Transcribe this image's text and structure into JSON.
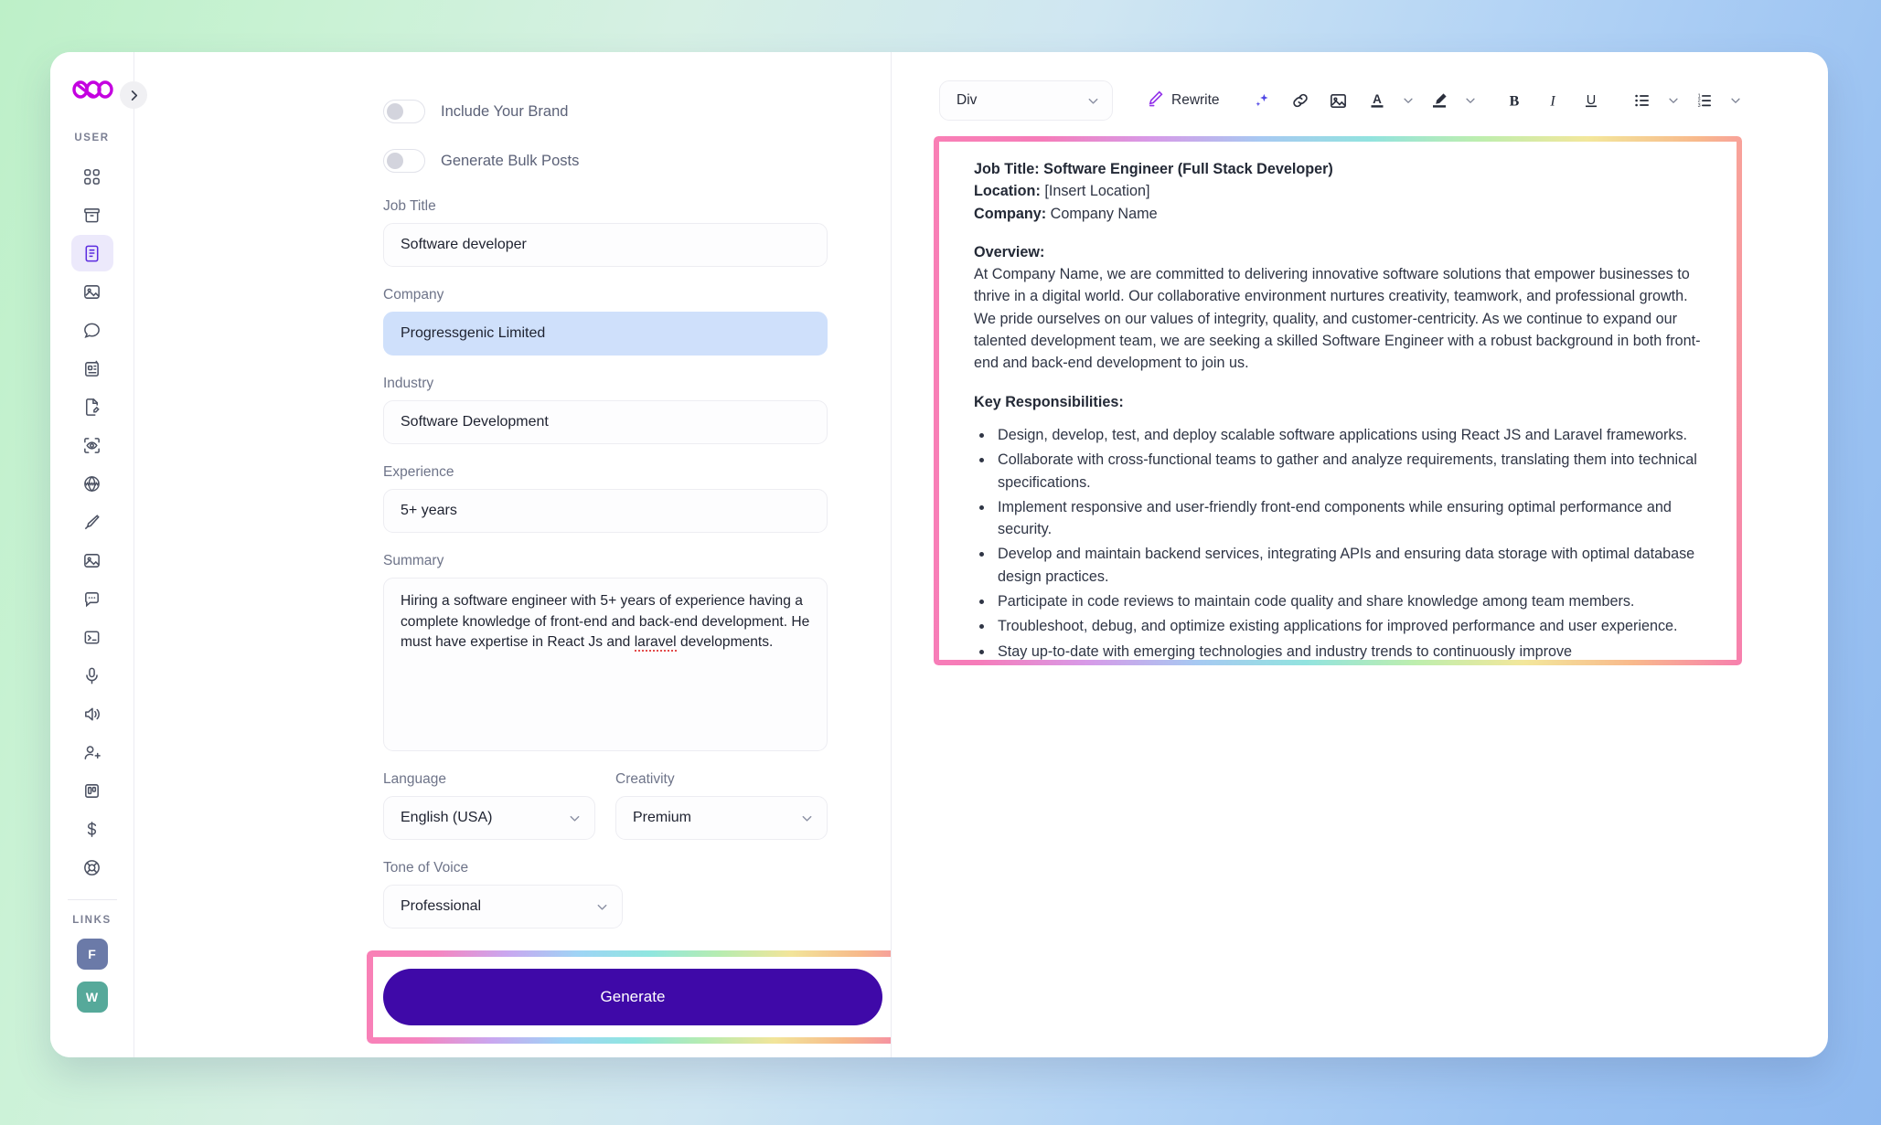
{
  "app": {
    "brand_logo": "infinity-hearts-logo",
    "collapse_icon": "chevron-right-icon"
  },
  "sidebar": {
    "section_label": "USER",
    "links_label": "LINKS",
    "items": [
      {
        "name": "dashboard-grid",
        "icon": "grid-icon",
        "active": false
      },
      {
        "name": "archive",
        "icon": "archive-box-icon",
        "active": false
      },
      {
        "name": "documents",
        "icon": "document-text-icon",
        "active": true
      },
      {
        "name": "images",
        "icon": "image-icon",
        "active": false
      },
      {
        "name": "chat",
        "icon": "chat-bubble-icon",
        "active": false
      },
      {
        "name": "templates",
        "icon": "file-card-icon",
        "active": false
      },
      {
        "name": "editor",
        "icon": "file-pencil-icon",
        "active": false
      },
      {
        "name": "vision",
        "icon": "scan-eye-icon",
        "active": false
      },
      {
        "name": "web",
        "icon": "www-globe-icon",
        "active": false
      },
      {
        "name": "design",
        "icon": "pen-tool-icon",
        "active": false
      },
      {
        "name": "gallery",
        "icon": "photo-icon",
        "active": false
      },
      {
        "name": "comments",
        "icon": "message-dots-icon",
        "active": false
      },
      {
        "name": "code",
        "icon": "terminal-icon",
        "active": false
      },
      {
        "name": "voice",
        "icon": "microphone-icon",
        "active": false
      },
      {
        "name": "audio",
        "icon": "speaker-icon",
        "active": false
      },
      {
        "name": "invite",
        "icon": "user-plus-icon",
        "active": false
      },
      {
        "name": "board",
        "icon": "kanban-board-icon",
        "active": false
      },
      {
        "name": "billing",
        "icon": "dollar-icon",
        "active": false
      },
      {
        "name": "support",
        "icon": "lifebuoy-icon",
        "active": false
      }
    ],
    "links": [
      {
        "name": "facebook-link",
        "letter": "F",
        "color": "#6b7aa8"
      },
      {
        "name": "whatsapp-link",
        "letter": "W",
        "color": "#56a99a"
      }
    ]
  },
  "form": {
    "toggles": [
      {
        "label": "Include Your Brand",
        "on": false
      },
      {
        "label": "Generate Bulk Posts",
        "on": false
      }
    ],
    "job_title": {
      "label": "Job Title",
      "value": "Software developer"
    },
    "company": {
      "label": "Company",
      "value": "Progressgenic Limited",
      "selected": true
    },
    "industry": {
      "label": "Industry",
      "value": "Software Development"
    },
    "experience": {
      "label": "Experience",
      "value": "5+ years"
    },
    "summary": {
      "label": "Summary",
      "value_pre": "Hiring a software engineer with 5+ years of experience having a complete knowledge of front-end and back-end development. He must have expertise in React Js and ",
      "value_misspelled": "laravel",
      "value_post": " developments."
    },
    "language": {
      "label": "Language",
      "value": "English (USA)"
    },
    "creativity": {
      "label": "Creativity",
      "value": "Premium"
    },
    "tone": {
      "label": "Tone of Voice",
      "value": "Professional"
    },
    "generate_button": "Generate",
    "accent_color": "#3f09a8",
    "highlight_color": "#f97fb5"
  },
  "editor": {
    "toolbar": {
      "block_select": "Div",
      "rewrite_label": "Rewrite",
      "icons": [
        "ai-sparkle-icon",
        "link-icon",
        "image-icon",
        "text-color-icon",
        "chevron-down-icon",
        "highlight-color-icon",
        "chevron-down-icon",
        "bold-icon",
        "italic-icon",
        "underline-icon",
        "bullet-list-icon",
        "chevron-down-icon",
        "numbered-list-icon",
        "chevron-down-icon"
      ]
    },
    "document": {
      "job_title_label": "Job Title:",
      "job_title_value": "Software Engineer (Full Stack Developer)",
      "location_label": "Location:",
      "location_value": "[Insert Location]",
      "company_label": "Company:",
      "company_value": "Company Name",
      "overview_heading": "Overview:",
      "overview_body": "At Company Name, we are committed to delivering innovative software solutions that empower businesses to thrive in a digital world. Our collaborative environment nurtures creativity, teamwork, and professional growth. We pride ourselves on our values of integrity, quality, and customer-centricity. As we continue to expand our talented development team, we are seeking a skilled Software Engineer with a robust background in both front-end and back-end development to join us.",
      "responsibilities_heading": "Key Responsibilities:",
      "responsibilities": [
        "Design, develop, test, and deploy scalable software applications using React JS and Laravel frameworks.",
        "Collaborate with cross-functional teams to gather and analyze requirements, translating them into technical specifications.",
        "Implement responsive and user-friendly front-end components while ensuring optimal performance and security.",
        "Develop and maintain backend services, integrating APIs and ensuring data storage with optimal database design practices.",
        "Participate in code reviews to maintain code quality and share knowledge among team members.",
        "Troubleshoot, debug, and optimize existing applications for improved performance and user experience.",
        "Stay up-to-date with emerging technologies and industry trends to continuously improve"
      ]
    }
  }
}
